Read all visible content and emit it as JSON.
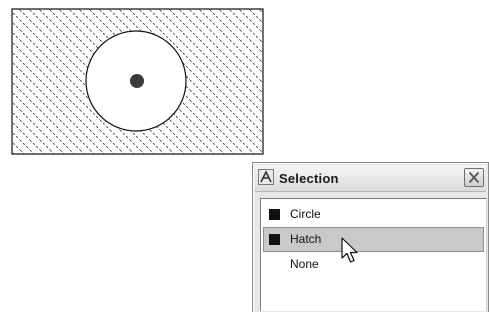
{
  "dialog": {
    "title": "Selection",
    "icon": "autocad-app-icon",
    "close_icon": "close-icon",
    "items": [
      {
        "label": "Circle",
        "swatch_color": "#111111",
        "highlighted": false
      },
      {
        "label": "Hatch",
        "swatch_color": "#111111",
        "highlighted": true
      },
      {
        "label": "None",
        "swatch_color": null,
        "highlighted": false
      }
    ]
  },
  "colors": {
    "hatch_pattern": "#333333",
    "highlight": "#c9c9c9",
    "dialog_bg": "#e7e7e7"
  }
}
